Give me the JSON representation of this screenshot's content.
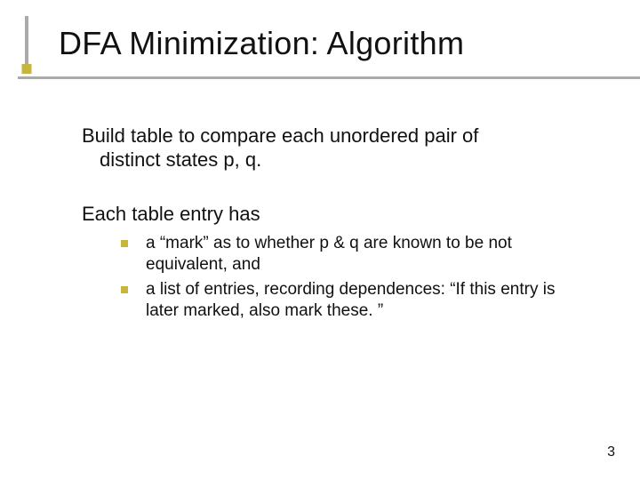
{
  "title": "DFA Minimization: Algorithm",
  "paragraphs": [
    "Build table to compare each unordered pair of distinct states p, q.",
    "Each table entry has"
  ],
  "paragraph1_indent": "distinct states p, q.",
  "paragraph1_first": "Build table to compare each unordered pair of",
  "bullets": [
    "a “mark” as to whether p & q are known to be not equivalent, and",
    "a list of entries, recording dependences:  “If this entry is later marked, also mark these. ”"
  ],
  "page_number": "3"
}
